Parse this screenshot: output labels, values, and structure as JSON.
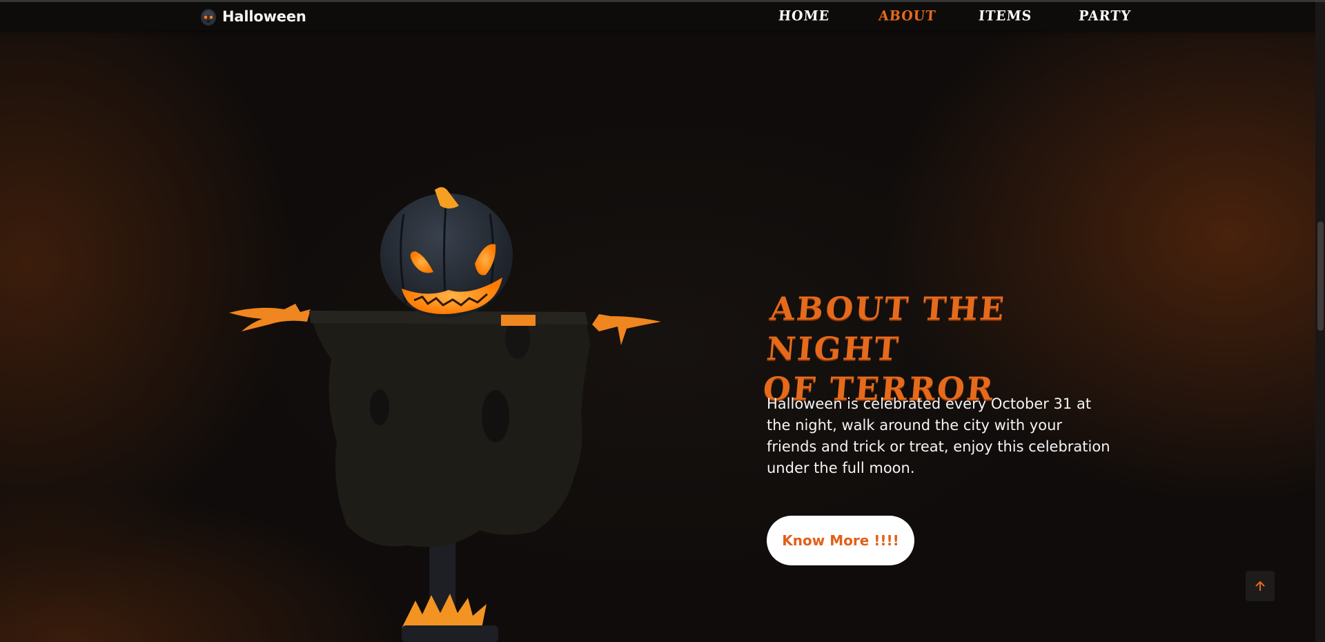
{
  "header": {
    "logo_text": "Halloween",
    "nav": [
      {
        "label": "HOME",
        "active": false
      },
      {
        "label": "ABOUT",
        "active": true
      },
      {
        "label": "ITEMS",
        "active": false
      },
      {
        "label": "PARTY",
        "active": false
      }
    ]
  },
  "about": {
    "title_line1": "ABOUT THE NIGHT",
    "title_line2": "OF TERROR",
    "description": "Halloween is celebrated every October 31 at the night, walk around the city with your friends and trick or treat, enjoy this celebration under the full moon.",
    "button_label": "Know More !!!!"
  },
  "icons": {
    "logo": "ghost-face-icon",
    "scroll_up": "arrow-up-icon",
    "hero_image": "pumpkin-scarecrow-image"
  },
  "colors": {
    "accent": "#e56a1c",
    "background": "#0f0c0b",
    "button_bg": "#ffffff",
    "text": "#f5f5f5"
  }
}
